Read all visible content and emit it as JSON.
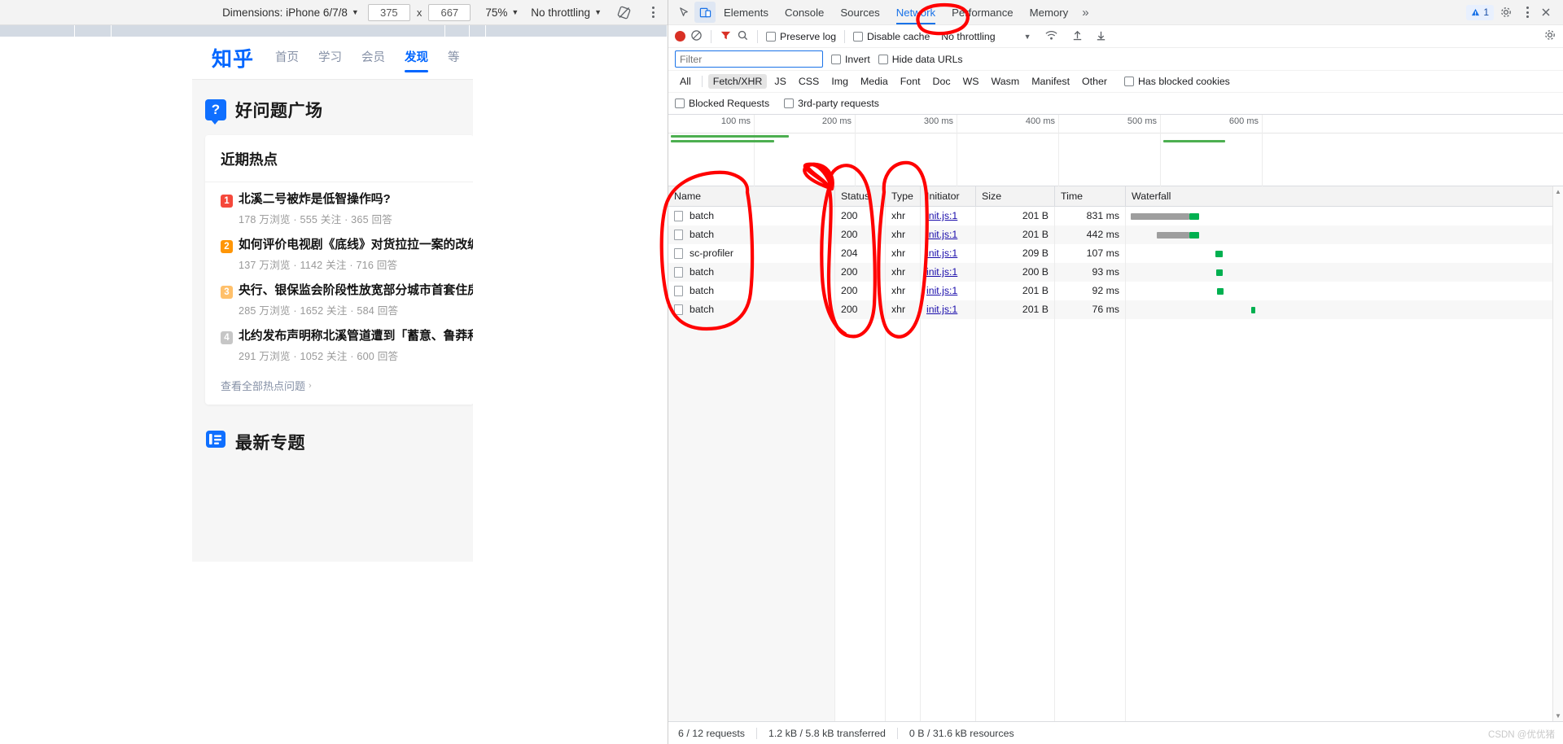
{
  "device_toolbar": {
    "dimensions_label": "Dimensions: iPhone 6/7/8",
    "width_value": "375",
    "times": "x",
    "height_value": "667",
    "zoom_value": "75%",
    "throttling_value": "No throttling",
    "rotate_icon": "rotate-icon",
    "menu_icon": "kebab-menu-icon"
  },
  "emulated_page": {
    "brand": "知乎",
    "nav": [
      {
        "label": "首页",
        "active": false
      },
      {
        "label": "学习",
        "active": false
      },
      {
        "label": "会员",
        "active": false
      },
      {
        "label": "发现",
        "active": true
      },
      {
        "label": "等",
        "active": false
      }
    ],
    "section_title": "好问题广场",
    "section_badge": "?",
    "card": {
      "heading": "近期热点",
      "items": [
        {
          "rank": "1",
          "rank_color": "#f5483b",
          "title": "北溪二号被炸是低智操作吗?",
          "meta": "178 万浏览 · 555 关注 · 365 回答"
        },
        {
          "rank": "2",
          "rank_color": "#ff9607",
          "title": "如何评价电视剧《底线》对货拉拉一案的改编?",
          "meta": "137 万浏览 · 1142 关注 · 716 回答"
        },
        {
          "rank": "3",
          "rank_color": "#ffc06a",
          "title": "央行、银保监会阶段性放宽部分城市首套住房贷",
          "meta": "285 万浏览 · 1652 关注 · 584 回答"
        },
        {
          "rank": "4",
          "rank_color": "#c6c6c6",
          "title": "北约发布声明称北溪管道遭到「蓄意、鲁莽和不",
          "meta": "291 万浏览 · 1052 关注 · 600 回答"
        }
      ],
      "more_label": "查看全部热点问题",
      "more_chevron": "›"
    },
    "second_section_title": "最新专题",
    "second_section_icon": "list-badge-icon"
  },
  "devtools": {
    "tabs": [
      {
        "label": "Elements",
        "active": false
      },
      {
        "label": "Console",
        "active": false
      },
      {
        "label": "Sources",
        "active": false
      },
      {
        "label": "Network",
        "active": true
      },
      {
        "label": "Performance",
        "active": false
      },
      {
        "label": "Memory",
        "active": false
      }
    ],
    "more_tabs_icon": "chevron-double-right-icon",
    "inspect_icon": "inspect-element-icon",
    "device_toggle_icon": "device-toolbar-icon",
    "warning_count": "1",
    "warning_icon": "warning-icon",
    "settings_icon": "gear-icon",
    "kebab_icon": "kebab-menu-icon",
    "close_icon": "close-icon",
    "controls": {
      "record_icon": "record-icon",
      "clear_icon": "clear-icon",
      "filter_icon": "filter-icon",
      "search_icon": "search-icon",
      "preserve_log": "Preserve log",
      "disable_cache": "Disable cache",
      "throttling_value": "No throttling",
      "wifi_icon": "network-conditions-icon",
      "import_icon": "import-har-icon",
      "export_icon": "export-har-icon",
      "settings_icon": "gear-icon"
    },
    "filter": {
      "placeholder": "Filter",
      "value": "",
      "invert_label": "Invert",
      "hide_data_urls_label": "Hide data URLs"
    },
    "type_filters": [
      {
        "label": "All",
        "active": false
      },
      {
        "label": "Fetch/XHR",
        "active": true
      },
      {
        "label": "JS",
        "active": false
      },
      {
        "label": "CSS",
        "active": false
      },
      {
        "label": "Img",
        "active": false
      },
      {
        "label": "Media",
        "active": false
      },
      {
        "label": "Font",
        "active": false
      },
      {
        "label": "Doc",
        "active": false
      },
      {
        "label": "WS",
        "active": false
      },
      {
        "label": "Wasm",
        "active": false
      },
      {
        "label": "Manifest",
        "active": false
      },
      {
        "label": "Other",
        "active": false
      }
    ],
    "has_blocked_cookies_label": "Has blocked cookies",
    "blocked_requests_label": "Blocked Requests",
    "third_party_label": "3rd-party requests",
    "overview": {
      "ticks": [
        "100 ms",
        "200 ms",
        "300 ms",
        "400 ms",
        "500 ms",
        "600 ms"
      ]
    },
    "table": {
      "columns": [
        "Name",
        "Status",
        "Type",
        "Initiator",
        "Size",
        "Time",
        "Waterfall"
      ],
      "rows": [
        {
          "name": "batch",
          "status": "200",
          "type": "xhr",
          "initiator": "init.js:1",
          "size": "201 B",
          "time": "831 ms"
        },
        {
          "name": "batch",
          "status": "200",
          "type": "xhr",
          "initiator": "init.js:1",
          "size": "201 B",
          "time": "442 ms"
        },
        {
          "name": "sc-profiler",
          "status": "204",
          "type": "xhr",
          "initiator": "init.js:1",
          "size": "209 B",
          "time": "107 ms"
        },
        {
          "name": "batch",
          "status": "200",
          "type": "xhr",
          "initiator": "init.js:1",
          "size": "200 B",
          "time": "93 ms"
        },
        {
          "name": "batch",
          "status": "200",
          "type": "xhr",
          "initiator": "init.js:1",
          "size": "201 B",
          "time": "92 ms"
        },
        {
          "name": "batch",
          "status": "200",
          "type": "xhr",
          "initiator": "init.js:1",
          "size": "201 B",
          "time": "76 ms"
        }
      ]
    },
    "status_bar": {
      "requests": "6 / 12 requests",
      "transferred": "1.2 kB / 5.8 kB transferred",
      "resources": "0 B / 31.6 kB resources"
    },
    "watermark": "CSDN @优优猪"
  },
  "colors": {
    "annotation": "#ff0000",
    "accent": "#1a73e8",
    "waterfall": "#00b050",
    "zhihu_blue": "#0066ff"
  }
}
